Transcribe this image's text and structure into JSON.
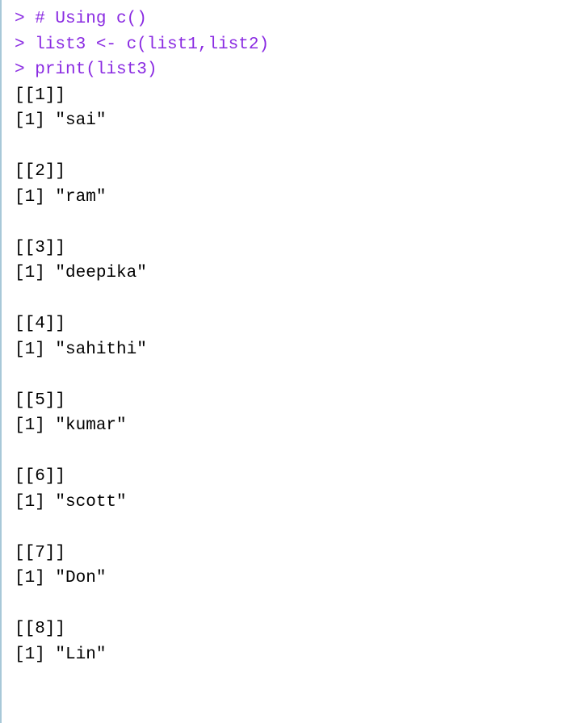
{
  "lines": [
    {
      "prompt": "> ",
      "code": "# Using c()"
    },
    {
      "prompt": "> ",
      "code": "list3 <- c(list1,list2)"
    },
    {
      "prompt": "> ",
      "code": "print(list3)"
    }
  ],
  "output_items": [
    {
      "index": "[[1]]",
      "value": "[1] \"sai\""
    },
    {
      "index": "[[2]]",
      "value": "[1] \"ram\""
    },
    {
      "index": "[[3]]",
      "value": "[1] \"deepika\""
    },
    {
      "index": "[[4]]",
      "value": "[1] \"sahithi\""
    },
    {
      "index": "[[5]]",
      "value": "[1] \"kumar\""
    },
    {
      "index": "[[6]]",
      "value": "[1] \"scott\""
    },
    {
      "index": "[[7]]",
      "value": "[1] \"Don\""
    },
    {
      "index": "[[8]]",
      "value": "[1] \"Lin\""
    }
  ]
}
